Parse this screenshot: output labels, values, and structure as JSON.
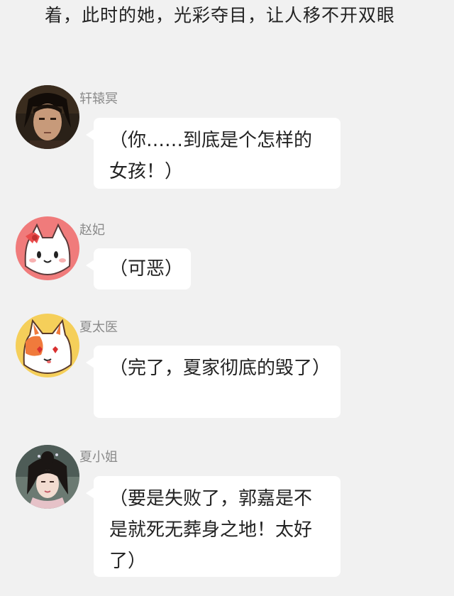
{
  "narration": "着，此时的她，光彩夺目，让人移不开双眼",
  "messages": [
    {
      "name": "轩辕冥",
      "text": "（你……到底是个怎样的女孩！）",
      "avatar_icon": "man-portrait-avatar"
    },
    {
      "name": "赵妃",
      "text": "（可恶）",
      "avatar_icon": "cat-bow-avatar"
    },
    {
      "name": "夏太医",
      "text": "（完了，夏家彻底的毁了）",
      "avatar_icon": "fox-avatar"
    },
    {
      "name": "夏小姐",
      "text": "（要是失败了，郭嘉是不是就死无葬身之地！太好了）",
      "avatar_icon": "woman-portrait-avatar"
    }
  ],
  "colors": {
    "background": "#f1f1f1",
    "bubble": "#ffffff",
    "name_text": "#8a8a8a",
    "cat_avatar_bg": "#f07b7b",
    "fox_avatar_bg": "#f5cf5a"
  }
}
